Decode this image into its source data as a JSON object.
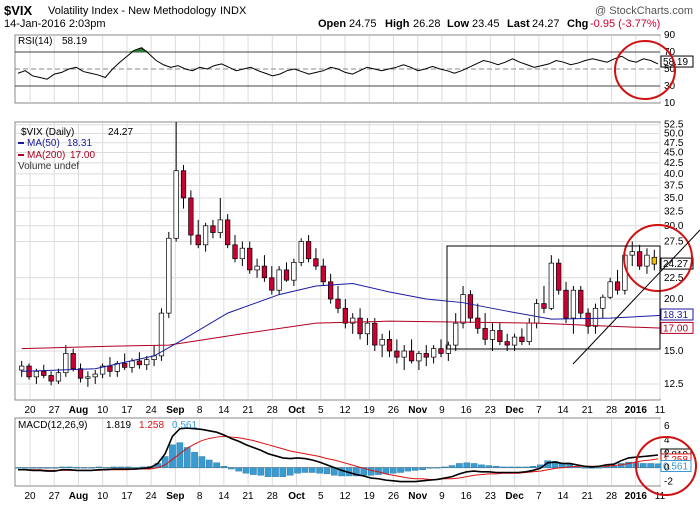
{
  "header": {
    "symbol": "$VIX",
    "name": "Volatility Index - New Methodology",
    "exchange": "INDX",
    "watermark": "@ StockCharts.com",
    "date": "14-Jan-2016 2:03pm",
    "open_label": "Open",
    "open": "24.75",
    "high_label": "High",
    "high": "26.28",
    "low_label": "Low",
    "low": "23.45",
    "last_label": "Last",
    "last": "24.27",
    "chg_label": "Chg",
    "chg": "-0.95 (-3.77%)"
  },
  "colors": {
    "up": "#ffffff",
    "down": "#cc0033",
    "ma50": "#1a1aa0",
    "ma200": "#b00020",
    "rsi": "#000000",
    "rsi_fill": "#2e7d32",
    "macd": "#000000",
    "signal": "#dd1111",
    "hist": "#3a9bd1",
    "annot": "#d01010",
    "grid": "#dcdcdc"
  },
  "chart_data": [
    {
      "type": "line",
      "panel": "rsi",
      "title": "RSI(14)",
      "last_value": "58.19",
      "ylim": [
        10,
        90
      ],
      "y_ticks": [
        "90",
        "70",
        "50",
        "30",
        "10"
      ],
      "overbought": 70,
      "oversold": 30,
      "values": [
        45,
        48,
        42,
        40,
        38,
        44,
        46,
        50,
        52,
        47,
        45,
        43,
        40,
        50,
        58,
        65,
        72,
        75,
        68,
        60,
        55,
        52,
        54,
        50,
        48,
        52,
        50,
        54,
        56,
        52,
        48,
        50,
        52,
        48,
        45,
        42,
        44,
        48,
        50,
        47,
        44,
        46,
        48,
        52,
        50,
        46,
        44,
        48,
        52,
        50,
        48,
        50,
        52,
        55,
        52,
        48,
        50,
        53,
        50,
        48,
        45,
        48,
        52,
        56,
        60,
        58,
        55,
        58,
        62,
        58,
        55,
        52,
        54,
        56,
        60,
        58,
        55,
        57,
        60,
        62,
        60,
        58,
        62,
        65,
        60,
        58,
        62,
        60,
        56
      ]
    },
    {
      "type": "candlestick",
      "panel": "price",
      "title": "$VIX (Daily)",
      "last_value": "24.27",
      "ma50_label": "MA(50)",
      "ma50_value": "18.31",
      "ma200_label": "MA(200)",
      "ma200_value": "17.00",
      "volume_label": "Volume undef",
      "ylim": [
        11.5,
        53
      ],
      "y_ticks": [
        "52.5",
        "50.0",
        "47.5",
        "45.0",
        "42.5",
        "40.0",
        "37.5",
        "35.0",
        "32.5",
        "30.0",
        "27.5",
        "22.5",
        "20.0",
        "15.0",
        "12.5"
      ],
      "last_tag": "24.27",
      "ma50_tag": "18.31",
      "ma200_tag": "17.00",
      "x_labels": [
        "20",
        "27",
        "Aug",
        "10",
        "17",
        "24",
        "Sep",
        "8",
        "14",
        "21",
        "28",
        "Oct",
        "5",
        "12",
        "19",
        "26",
        "Nov",
        "9",
        "16",
        "23",
        "Dec",
        "7",
        "14",
        "21",
        "28",
        "2016",
        "11"
      ],
      "ohlc": [
        [
          13.5,
          14.2,
          13.0,
          13.8
        ],
        [
          13.8,
          14.0,
          12.8,
          13.0
        ],
        [
          13.0,
          13.6,
          12.5,
          13.4
        ],
        [
          13.4,
          13.9,
          12.9,
          13.1
        ],
        [
          13.1,
          13.4,
          12.4,
          12.7
        ],
        [
          12.7,
          13.6,
          12.5,
          13.3
        ],
        [
          13.3,
          15.5,
          13.0,
          14.8
        ],
        [
          14.8,
          15.2,
          13.4,
          13.6
        ],
        [
          13.6,
          14.0,
          12.6,
          12.9
        ],
        [
          12.9,
          13.4,
          12.3,
          13.0
        ],
        [
          13.0,
          13.5,
          12.5,
          13.2
        ],
        [
          13.2,
          14.0,
          12.9,
          13.8
        ],
        [
          13.8,
          14.5,
          13.0,
          13.4
        ],
        [
          13.4,
          14.2,
          13.0,
          14.0
        ],
        [
          14.0,
          14.8,
          13.5,
          13.7
        ],
        [
          13.7,
          14.4,
          13.3,
          14.2
        ],
        [
          14.2,
          14.9,
          13.6,
          13.9
        ],
        [
          13.9,
          14.6,
          13.5,
          14.3
        ],
        [
          14.3,
          15.5,
          13.8,
          14.6
        ],
        [
          14.6,
          19.0,
          14.2,
          18.5
        ],
        [
          18.5,
          29.0,
          18.0,
          28.0
        ],
        [
          28.0,
          53.3,
          27.5,
          40.7
        ],
        [
          40.7,
          42.0,
          33.0,
          35.0
        ],
        [
          35.0,
          36.5,
          27.0,
          28.5
        ],
        [
          28.5,
          31.0,
          26.5,
          27.0
        ],
        [
          27.0,
          30.5,
          26.0,
          30.0
        ],
        [
          30.0,
          31.0,
          28.0,
          28.9
        ],
        [
          28.9,
          35.0,
          28.0,
          31.0
        ],
        [
          31.0,
          32.0,
          26.5,
          27.0
        ],
        [
          27.0,
          28.5,
          24.5,
          25.0
        ],
        [
          25.0,
          27.5,
          24.0,
          26.5
        ],
        [
          26.5,
          27.5,
          23.0,
          23.5
        ],
        [
          23.5,
          25.0,
          22.5,
          24.0
        ],
        [
          24.0,
          25.5,
          22.0,
          22.5
        ],
        [
          22.5,
          24.0,
          20.5,
          21.0
        ],
        [
          21.0,
          24.0,
          20.5,
          23.5
        ],
        [
          23.5,
          24.5,
          22.0,
          22.2
        ],
        [
          22.2,
          25.0,
          21.5,
          24.5
        ],
        [
          24.5,
          28.0,
          24.0,
          27.5
        ],
        [
          27.5,
          28.5,
          24.5,
          25.0
        ],
        [
          25.0,
          26.5,
          23.5,
          24.0
        ],
        [
          24.0,
          25.0,
          21.5,
          22.0
        ],
        [
          22.0,
          23.0,
          19.5,
          20.0
        ],
        [
          20.0,
          21.5,
          18.5,
          19.0
        ],
        [
          19.0,
          20.0,
          17.0,
          17.5
        ],
        [
          17.5,
          18.5,
          16.5,
          18.0
        ],
        [
          18.0,
          19.0,
          16.0,
          16.5
        ],
        [
          16.5,
          18.0,
          15.5,
          17.5
        ],
        [
          17.5,
          18.0,
          15.0,
          15.5
        ],
        [
          15.5,
          16.5,
          14.5,
          16.0
        ],
        [
          16.0,
          16.8,
          14.5,
          15.0
        ],
        [
          15.0,
          16.0,
          14.0,
          14.5
        ],
        [
          14.5,
          15.5,
          13.5,
          15.0
        ],
        [
          15.0,
          16.0,
          14.0,
          14.2
        ],
        [
          14.2,
          15.0,
          13.5,
          14.8
        ],
        [
          14.8,
          15.5,
          13.8,
          14.5
        ],
        [
          14.5,
          15.5,
          14.0,
          15.2
        ],
        [
          15.2,
          16.0,
          14.5,
          14.8
        ],
        [
          14.8,
          15.8,
          14.2,
          15.5
        ],
        [
          15.5,
          18.5,
          15.0,
          17.5
        ],
        [
          17.5,
          21.5,
          17.0,
          20.5
        ],
        [
          20.5,
          21.0,
          17.5,
          18.0
        ],
        [
          18.0,
          19.5,
          16.5,
          17.0
        ],
        [
          17.0,
          18.5,
          15.5,
          16.0
        ],
        [
          16.0,
          17.5,
          15.0,
          16.8
        ],
        [
          16.8,
          17.5,
          15.5,
          15.8
        ],
        [
          15.8,
          16.5,
          15.0,
          15.5
        ],
        [
          15.5,
          16.5,
          15.0,
          16.2
        ],
        [
          16.2,
          17.0,
          15.5,
          15.8
        ],
        [
          15.8,
          18.0,
          15.5,
          17.5
        ],
        [
          17.5,
          20.0,
          17.0,
          19.5
        ],
        [
          19.5,
          21.5,
          18.5,
          19.0
        ],
        [
          19.0,
          25.5,
          18.8,
          24.4
        ],
        [
          24.4,
          25.0,
          20.5,
          21.0
        ],
        [
          21.0,
          22.0,
          17.5,
          18.0
        ],
        [
          18.0,
          21.5,
          16.5,
          21.0
        ],
        [
          21.0,
          21.5,
          18.0,
          18.5
        ],
        [
          18.5,
          19.0,
          16.5,
          17.2
        ],
        [
          17.2,
          19.5,
          16.5,
          19.0
        ],
        [
          19.0,
          20.5,
          18.0,
          20.2
        ],
        [
          20.2,
          22.5,
          20.0,
          22.0
        ],
        [
          22.0,
          23.5,
          20.5,
          21.0
        ],
        [
          21.0,
          26.5,
          20.5,
          25.5
        ],
        [
          25.5,
          27.5,
          24.0,
          26.0
        ],
        [
          26.0,
          27.0,
          23.5,
          24.0
        ],
        [
          24.0,
          26.5,
          23.0,
          25.5
        ],
        [
          25.2,
          26.28,
          23.45,
          24.27
        ]
      ],
      "ma50": [
        [
          0,
          13.4
        ],
        [
          10,
          13.6
        ],
        [
          18,
          14.6
        ],
        [
          22,
          16.0
        ],
        [
          28,
          18.5
        ],
        [
          35,
          20.5
        ],
        [
          40,
          21.5
        ],
        [
          45,
          21.8
        ],
        [
          50,
          20.8
        ],
        [
          55,
          20.0
        ],
        [
          60,
          19.6
        ],
        [
          66,
          18.7
        ],
        [
          72,
          17.9
        ],
        [
          80,
          18.0
        ],
        [
          88,
          18.31
        ]
      ],
      "ma200": [
        [
          0,
          15.2
        ],
        [
          12,
          15.4
        ],
        [
          20,
          15.5
        ],
        [
          30,
          16.5
        ],
        [
          40,
          17.5
        ],
        [
          50,
          17.7
        ],
        [
          60,
          17.6
        ],
        [
          70,
          17.5
        ],
        [
          80,
          17.2
        ],
        [
          88,
          17.0
        ]
      ]
    },
    {
      "type": "bar+line",
      "panel": "macd",
      "title": "MACD(12,26,9)",
      "macd_value": "1.819",
      "signal_value": "1.258",
      "hist_value": "0.561",
      "ylim": [
        -2.5,
        7
      ],
      "y_ticks": [
        "6",
        "4",
        "2",
        "0",
        "-2"
      ],
      "macd": [
        -0.3,
        -0.3,
        -0.4,
        -0.4,
        -0.5,
        -0.5,
        -0.3,
        -0.3,
        -0.4,
        -0.4,
        -0.4,
        -0.3,
        -0.3,
        -0.2,
        -0.2,
        -0.2,
        -0.2,
        -0.1,
        0.0,
        0.6,
        2.0,
        4.5,
        5.6,
        5.7,
        5.6,
        5.5,
        5.3,
        5.1,
        4.7,
        4.2,
        3.8,
        3.3,
        2.9,
        2.5,
        2.0,
        1.7,
        1.4,
        1.3,
        1.4,
        1.3,
        1.1,
        0.8,
        0.4,
        0.0,
        -0.4,
        -0.7,
        -1.0,
        -1.2,
        -1.5,
        -1.6,
        -1.8,
        -1.9,
        -2.0,
        -2.0,
        -2.0,
        -1.9,
        -1.8,
        -1.7,
        -1.5,
        -1.3,
        -0.9,
        -0.6,
        -0.5,
        -0.6,
        -0.6,
        -0.7,
        -0.7,
        -0.7,
        -0.7,
        -0.6,
        -0.4,
        -0.1,
        0.7,
        0.8,
        0.6,
        0.6,
        0.4,
        0.2,
        0.1,
        0.2,
        0.4,
        0.5,
        1.0,
        1.4,
        1.5,
        1.6,
        1.7,
        1.82
      ],
      "signal": [
        -0.3,
        -0.3,
        -0.3,
        -0.3,
        -0.4,
        -0.4,
        -0.4,
        -0.4,
        -0.4,
        -0.4,
        -0.4,
        -0.4,
        -0.3,
        -0.3,
        -0.3,
        -0.3,
        -0.2,
        -0.2,
        -0.2,
        0.0,
        0.4,
        1.2,
        2.0,
        2.8,
        3.4,
        3.9,
        4.2,
        4.4,
        4.5,
        4.4,
        4.3,
        4.1,
        3.9,
        3.6,
        3.3,
        3.0,
        2.7,
        2.4,
        2.2,
        2.0,
        1.8,
        1.6,
        1.3,
        1.1,
        0.8,
        0.5,
        0.2,
        -0.1,
        -0.4,
        -0.6,
        -0.9,
        -1.1,
        -1.3,
        -1.5,
        -1.6,
        -1.6,
        -1.7,
        -1.7,
        -1.6,
        -1.6,
        -1.5,
        -1.3,
        -1.1,
        -1.0,
        -0.9,
        -0.9,
        -0.8,
        -0.8,
        -0.8,
        -0.7,
        -0.6,
        -0.5,
        -0.3,
        -0.1,
        0.0,
        0.1,
        0.2,
        0.2,
        0.2,
        0.2,
        0.2,
        0.3,
        0.4,
        0.6,
        0.8,
        1.0,
        1.1,
        1.26
      ]
    }
  ]
}
